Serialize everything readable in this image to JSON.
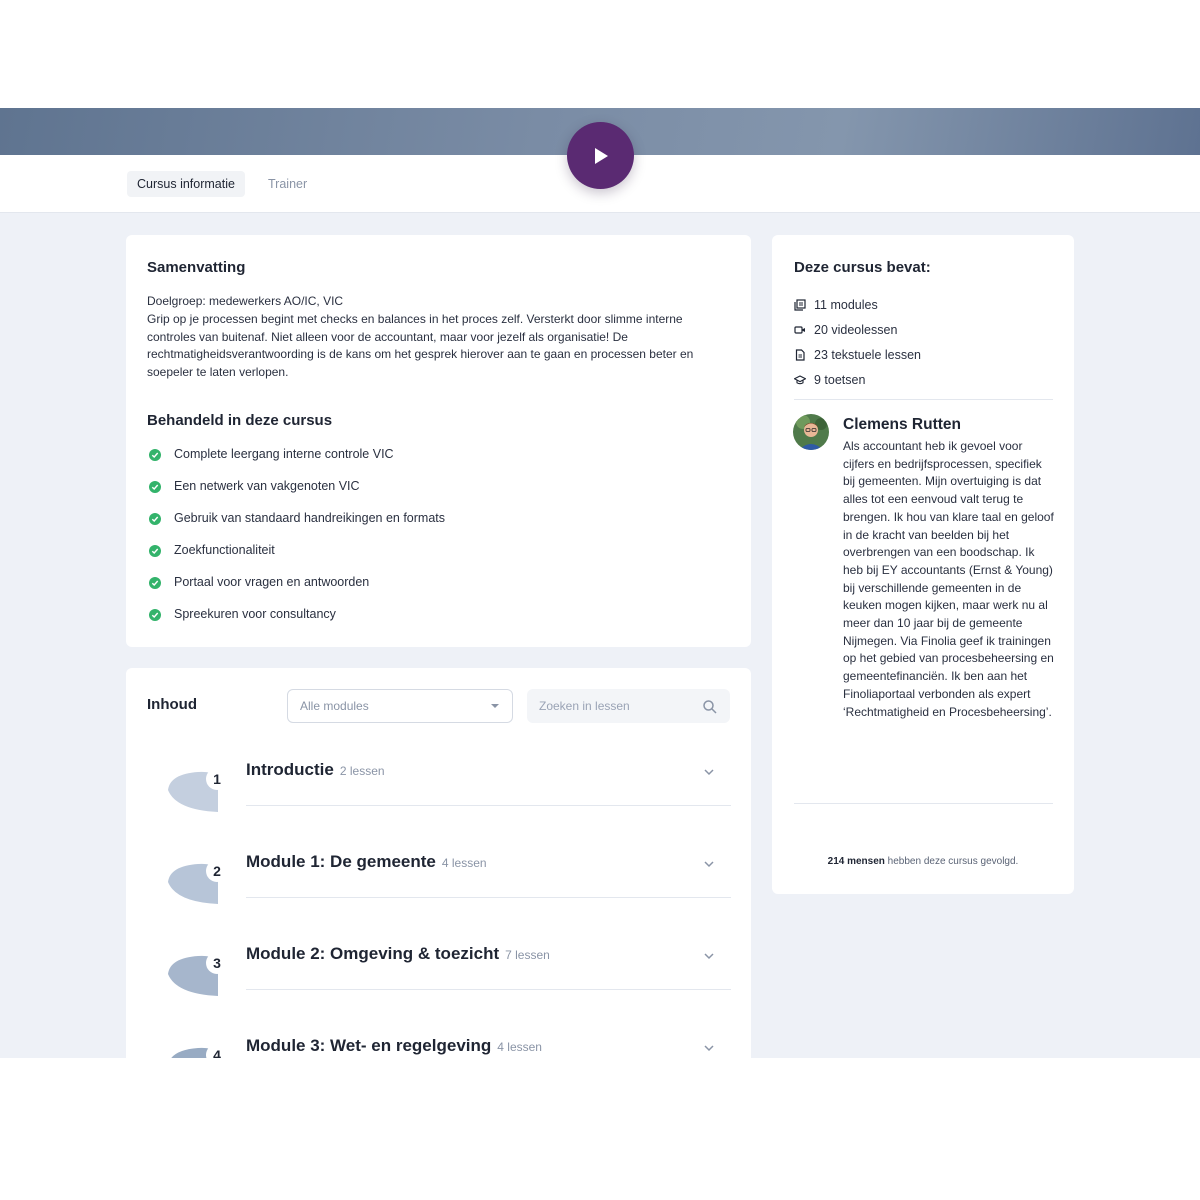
{
  "tabs": [
    {
      "label": "Cursus informatie",
      "active": true
    },
    {
      "label": "Trainer",
      "active": false
    }
  ],
  "summary": {
    "title": "Samenvatting",
    "audience": "Doelgroep: medewerkers AO/IC, VIC",
    "text": "Grip op je processen begint met checks en balances in het proces zelf. Versterkt door slimme interne controles van buitenaf. Niet alleen voor de accountant, maar voor jezelf als organisatie! De rechtmatigheidsverantwoording is de kans om het gesprek hierover aan te gaan en processen beter en soepeler te laten verlopen."
  },
  "covered": {
    "title": "Behandeld in deze cursus",
    "items": [
      "Complete leergang interne controle VIC",
      "Een netwerk van vakgenoten VIC",
      "Gebruik van standaard handreikingen en formats",
      "Zoekfunctionaliteit",
      "Portaal voor vragen en antwoorden",
      "Spreekuren voor consultancy"
    ]
  },
  "contents": {
    "title": "Inhoud",
    "filter_selected": "Alle modules",
    "search_placeholder": "Zoeken in lessen",
    "modules": [
      {
        "num": "1",
        "title": "Introductie",
        "lessons": "2 lessen"
      },
      {
        "num": "2",
        "title": "Module 1: De gemeente",
        "lessons": "4 lessen"
      },
      {
        "num": "3",
        "title": "Module 2: Omgeving & toezicht",
        "lessons": "7 lessen"
      },
      {
        "num": "4",
        "title": "Module 3: Wet- en regelgeving",
        "lessons": "4 lessen"
      }
    ]
  },
  "course_facts": {
    "title": "Deze cursus bevat:",
    "items": [
      {
        "icon": "modules-icon",
        "label": "11 modules"
      },
      {
        "icon": "video-icon",
        "label": "20 videolessen"
      },
      {
        "icon": "document-icon",
        "label": "23 tekstuele lessen"
      },
      {
        "icon": "graduation-cap-icon",
        "label": "9 toetsen"
      }
    ]
  },
  "trainer": {
    "name": "Clemens Rutten",
    "bio": "Als accountant heb ik gevoel voor cijfers en bedrijfsprocessen, specifiek bij gemeenten. Mijn overtuiging is dat alles tot een eenvoud valt terug te brengen. Ik hou van klare taal en geloof in de kracht van beelden bij het overbrengen van een boodschap. Ik heb bij EY accountants (Ernst & Young) bij verschillende gemeenten in de keuken mogen kijken, maar werk nu al meer dan 10 jaar bij de gemeente Nijmegen. Via Finolia geef ik trainingen op het gebied van procesbeheersing en gemeentefinanciën. Ik ben aan het Finoliaportaal verbonden als expert ‘Rechtmatigheid en Procesbeheersing’."
  },
  "followers": {
    "count": "214 mensen",
    "suffix": " hebben deze cursus gevolgd."
  },
  "colors": {
    "accent": "#5a2a72",
    "check": "#33b36b",
    "hero_start": "#5f7490",
    "background": "#eef1f7"
  }
}
